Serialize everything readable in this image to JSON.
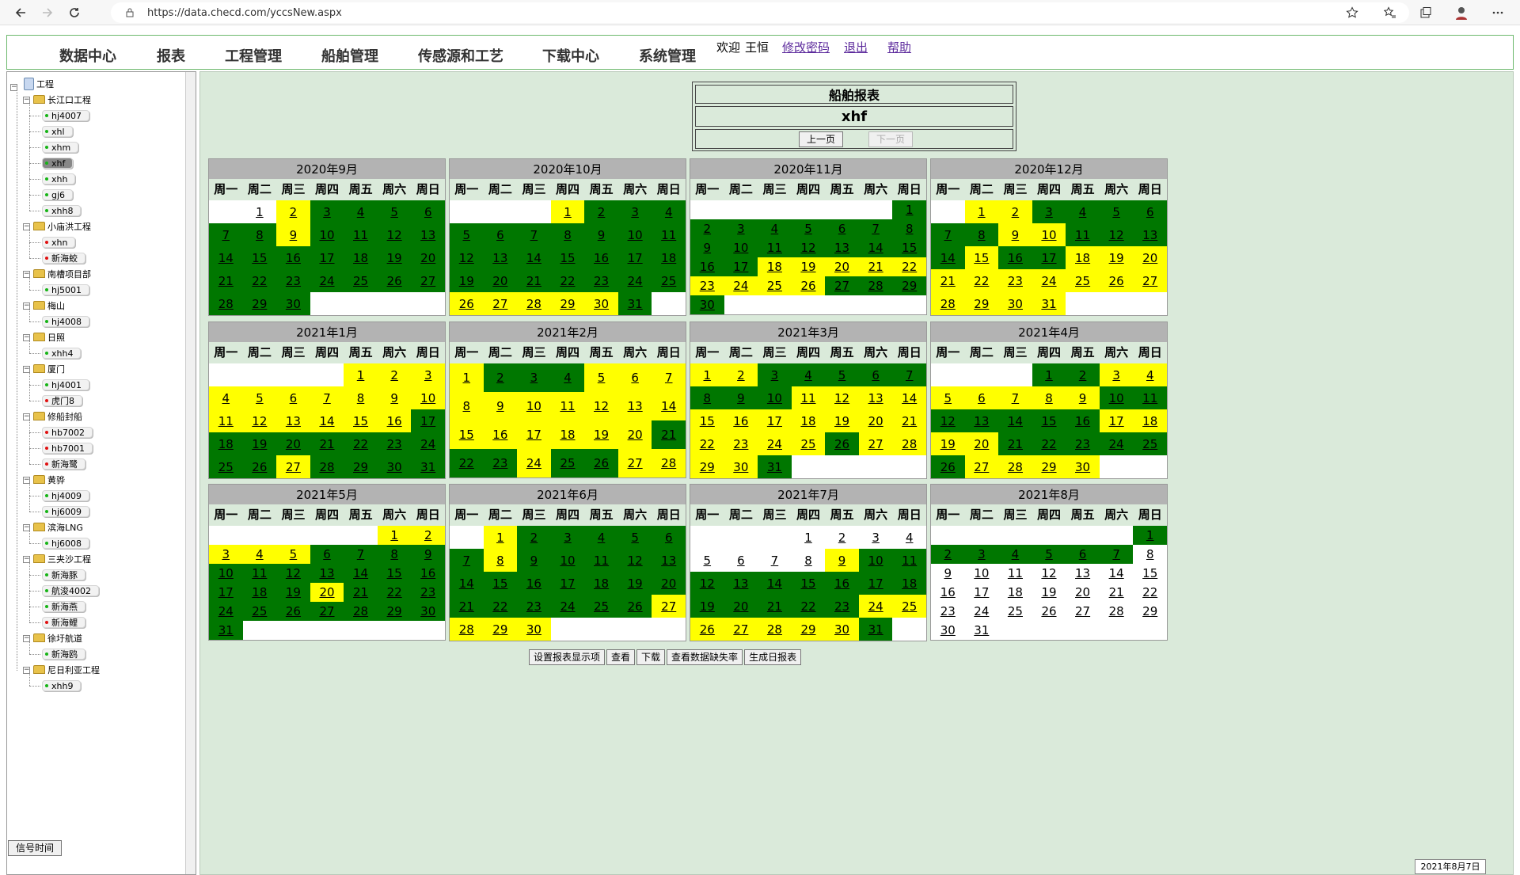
{
  "browser": {
    "url": "https://data.checd.com/yccsNew.aspx"
  },
  "nav": {
    "menu": [
      "数据中心",
      "报表",
      "工程管理",
      "船舶管理",
      "传感源和工艺",
      "下载中心",
      "系统管理"
    ],
    "welcome": "欢迎",
    "user": "王恒",
    "change_pwd": "修改密码",
    "logout": "退出",
    "help": "帮助"
  },
  "tree": {
    "root": "工程",
    "groups": [
      {
        "label": "长江口工程",
        "items": [
          {
            "label": "hj4007",
            "status": "green"
          },
          {
            "label": "xhl",
            "status": "green"
          },
          {
            "label": "xhm",
            "status": "green"
          },
          {
            "label": "xhf",
            "status": "green",
            "selected": true
          },
          {
            "label": "xhh",
            "status": "green"
          },
          {
            "label": "gj6",
            "status": "green"
          },
          {
            "label": "xhh8",
            "status": "green"
          }
        ]
      },
      {
        "label": "小庙洪工程",
        "items": [
          {
            "label": "xhn",
            "status": "red"
          },
          {
            "label": "新海蛟",
            "status": "red"
          }
        ]
      },
      {
        "label": "南槽项目部",
        "items": [
          {
            "label": "hj5001",
            "status": "green"
          }
        ]
      },
      {
        "label": "梅山",
        "items": [
          {
            "label": "hj4008",
            "status": "green"
          }
        ]
      },
      {
        "label": "日照",
        "items": [
          {
            "label": "xhh4",
            "status": "green"
          }
        ]
      },
      {
        "label": "厦门",
        "items": [
          {
            "label": "hj4001",
            "status": "green"
          },
          {
            "label": "虎门8",
            "status": "red"
          }
        ]
      },
      {
        "label": "修船封船",
        "items": [
          {
            "label": "hb7002",
            "status": "red"
          },
          {
            "label": "hb7001",
            "status": "red"
          },
          {
            "label": "新海鹭",
            "status": "red"
          }
        ]
      },
      {
        "label": "黄骅",
        "items": [
          {
            "label": "hj4009",
            "status": "green"
          },
          {
            "label": "hj6009",
            "status": "green"
          }
        ]
      },
      {
        "label": "滨海LNG",
        "items": [
          {
            "label": "hj6008",
            "status": "green"
          }
        ]
      },
      {
        "label": "三夹沙工程",
        "items": [
          {
            "label": "新海豚",
            "status": "green"
          },
          {
            "label": "航浚4002",
            "status": "green"
          },
          {
            "label": "新海燕",
            "status": "green"
          },
          {
            "label": "新海鲤",
            "status": "red"
          }
        ]
      },
      {
        "label": "徐圩航道",
        "items": [
          {
            "label": "新海鸥",
            "status": "green"
          }
        ]
      },
      {
        "label": "尼日利亚工程",
        "items": [
          {
            "label": "xhh9",
            "status": "green"
          }
        ]
      }
    ]
  },
  "signal_button": "信号时间",
  "report": {
    "title": "船舶报表",
    "ship": "xhf",
    "prev": "上一页",
    "next": "下一页"
  },
  "weekdays": [
    "周一",
    "周二",
    "周三",
    "周四",
    "周五",
    "周六",
    "周日"
  ],
  "legend_colors": {
    "green": "#007700",
    "yellow": "#ffff00",
    "empty": "#ffffff"
  },
  "months": [
    {
      "title": "2020年9月",
      "offset": 1,
      "days": 30,
      "colors": "wyggggggyggggggggggggggggggggg"
    },
    {
      "title": "2020年10月",
      "offset": 3,
      "days": 31,
      "colors": "yggggggggggggggggggggggggyyyyy"
    },
    {
      "title": "2020年11月",
      "offset": 6,
      "days": 30,
      "colors": "gggggggggggggggggyyyyyyyyyggggg"
    },
    {
      "title": "2020年12月",
      "offset": 1,
      "days": 31,
      "colors": "yyggggggyyggggyggyyyyyyyyyyyyyyy"
    },
    {
      "title": "2021年1月",
      "offset": 4,
      "days": 31,
      "colors": "yyyyyyyyyyyyyyyyggggggggggygggggg"
    },
    {
      "title": "2021年2月",
      "offset": 0,
      "days": 28,
      "colors": "ygggyyyyyyyyyyyyyyyygggyggyyyy"
    },
    {
      "title": "2021年3月",
      "offset": 0,
      "days": 31,
      "colors": "yyggggggggyyyyyyyyyyyyyyygyyyygggg"
    },
    {
      "title": "2021年4月",
      "offset": 3,
      "days": 30,
      "colors": "ggyyyyyyygggggggyyyyggggggyyyyyyy"
    },
    {
      "title": "2021年5月",
      "offset": 5,
      "days": 31,
      "colors": "yyyyyggggggggggggggyggggggggggggg"
    },
    {
      "title": "2021年6月",
      "offset": 1,
      "days": 30,
      "colors": "yggggggyggggggggggggggggggyyyyyl"
    },
    {
      "title": "2021年7月",
      "offset": 3,
      "days": 31,
      "colors": "wwwwwwwwyggggggggggggggyyyyyyyggg"
    },
    {
      "title": "2021年8月",
      "offset": 6,
      "days": 31,
      "colors": "gggggggwwwwwwwwwwwwwwwwwwwwwwwwww"
    }
  ],
  "actions": [
    "设置报表显示项",
    "查看",
    "下载",
    "查看数据缺失率",
    "生成日报表"
  ],
  "date_stamp": "2021年8月7日"
}
